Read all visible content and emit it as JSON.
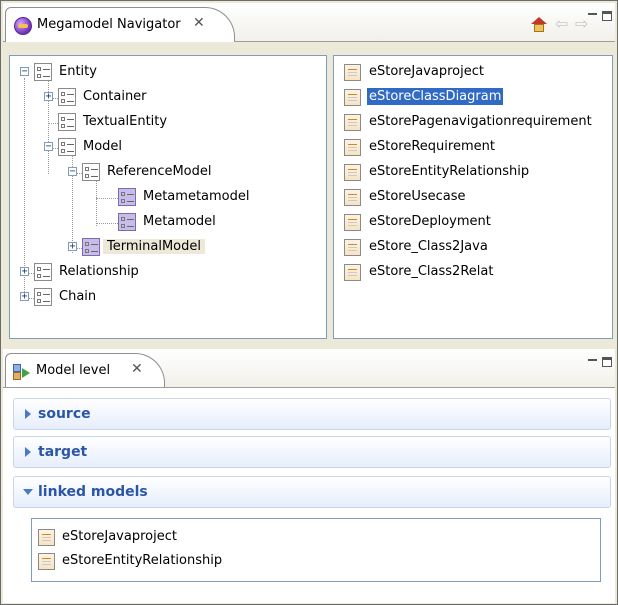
{
  "navigator": {
    "title": "Megamodel Navigator",
    "close_glyph": "✕",
    "toolbar": {
      "home_icon": "home-icon",
      "back_glyph": "⇦",
      "forward_glyph": "⇨"
    },
    "tree": [
      {
        "label": "Entity",
        "level": 0,
        "expander": "−"
      },
      {
        "label": "Container",
        "level": 1,
        "expander": "+"
      },
      {
        "label": "TextualEntity",
        "level": 1,
        "expander": ""
      },
      {
        "label": "Model",
        "level": 1,
        "expander": "−"
      },
      {
        "label": "ReferenceModel",
        "level": 2,
        "expander": "−"
      },
      {
        "label": "Metametamodel",
        "level": 3,
        "expander": ""
      },
      {
        "label": "Metamodel",
        "level": 3,
        "expander": ""
      },
      {
        "label": "TerminalModel",
        "level": 2,
        "expander": "+"
      },
      {
        "label": "Relationship",
        "level": 0,
        "expander": "+"
      },
      {
        "label": "Chain",
        "level": 0,
        "expander": "+"
      }
    ],
    "selected_tree_item": "TerminalModel",
    "models": [
      "eStoreJavaproject",
      "eStoreClassDiagram",
      "eStorePagenavigationrequirement",
      "eStoreRequirement",
      "eStoreEntityRelationship",
      "eStoreUsecase",
      "eStoreDeployment",
      "eStore_Class2Java",
      "eStore_Class2Relat"
    ],
    "selected_model": "eStoreClassDiagram"
  },
  "model_level": {
    "title": "Model level",
    "close_glyph": "✕",
    "sections": [
      {
        "title": "source",
        "expanded": false
      },
      {
        "title": "target",
        "expanded": false
      },
      {
        "title": "linked models",
        "expanded": true
      }
    ],
    "linked_models": [
      "eStoreJavaproject",
      "eStoreEntityRelationship"
    ]
  },
  "colors": {
    "selection": "#316ac5",
    "section_title": "#2b56a8",
    "frame_bg": "#ece9d8"
  }
}
